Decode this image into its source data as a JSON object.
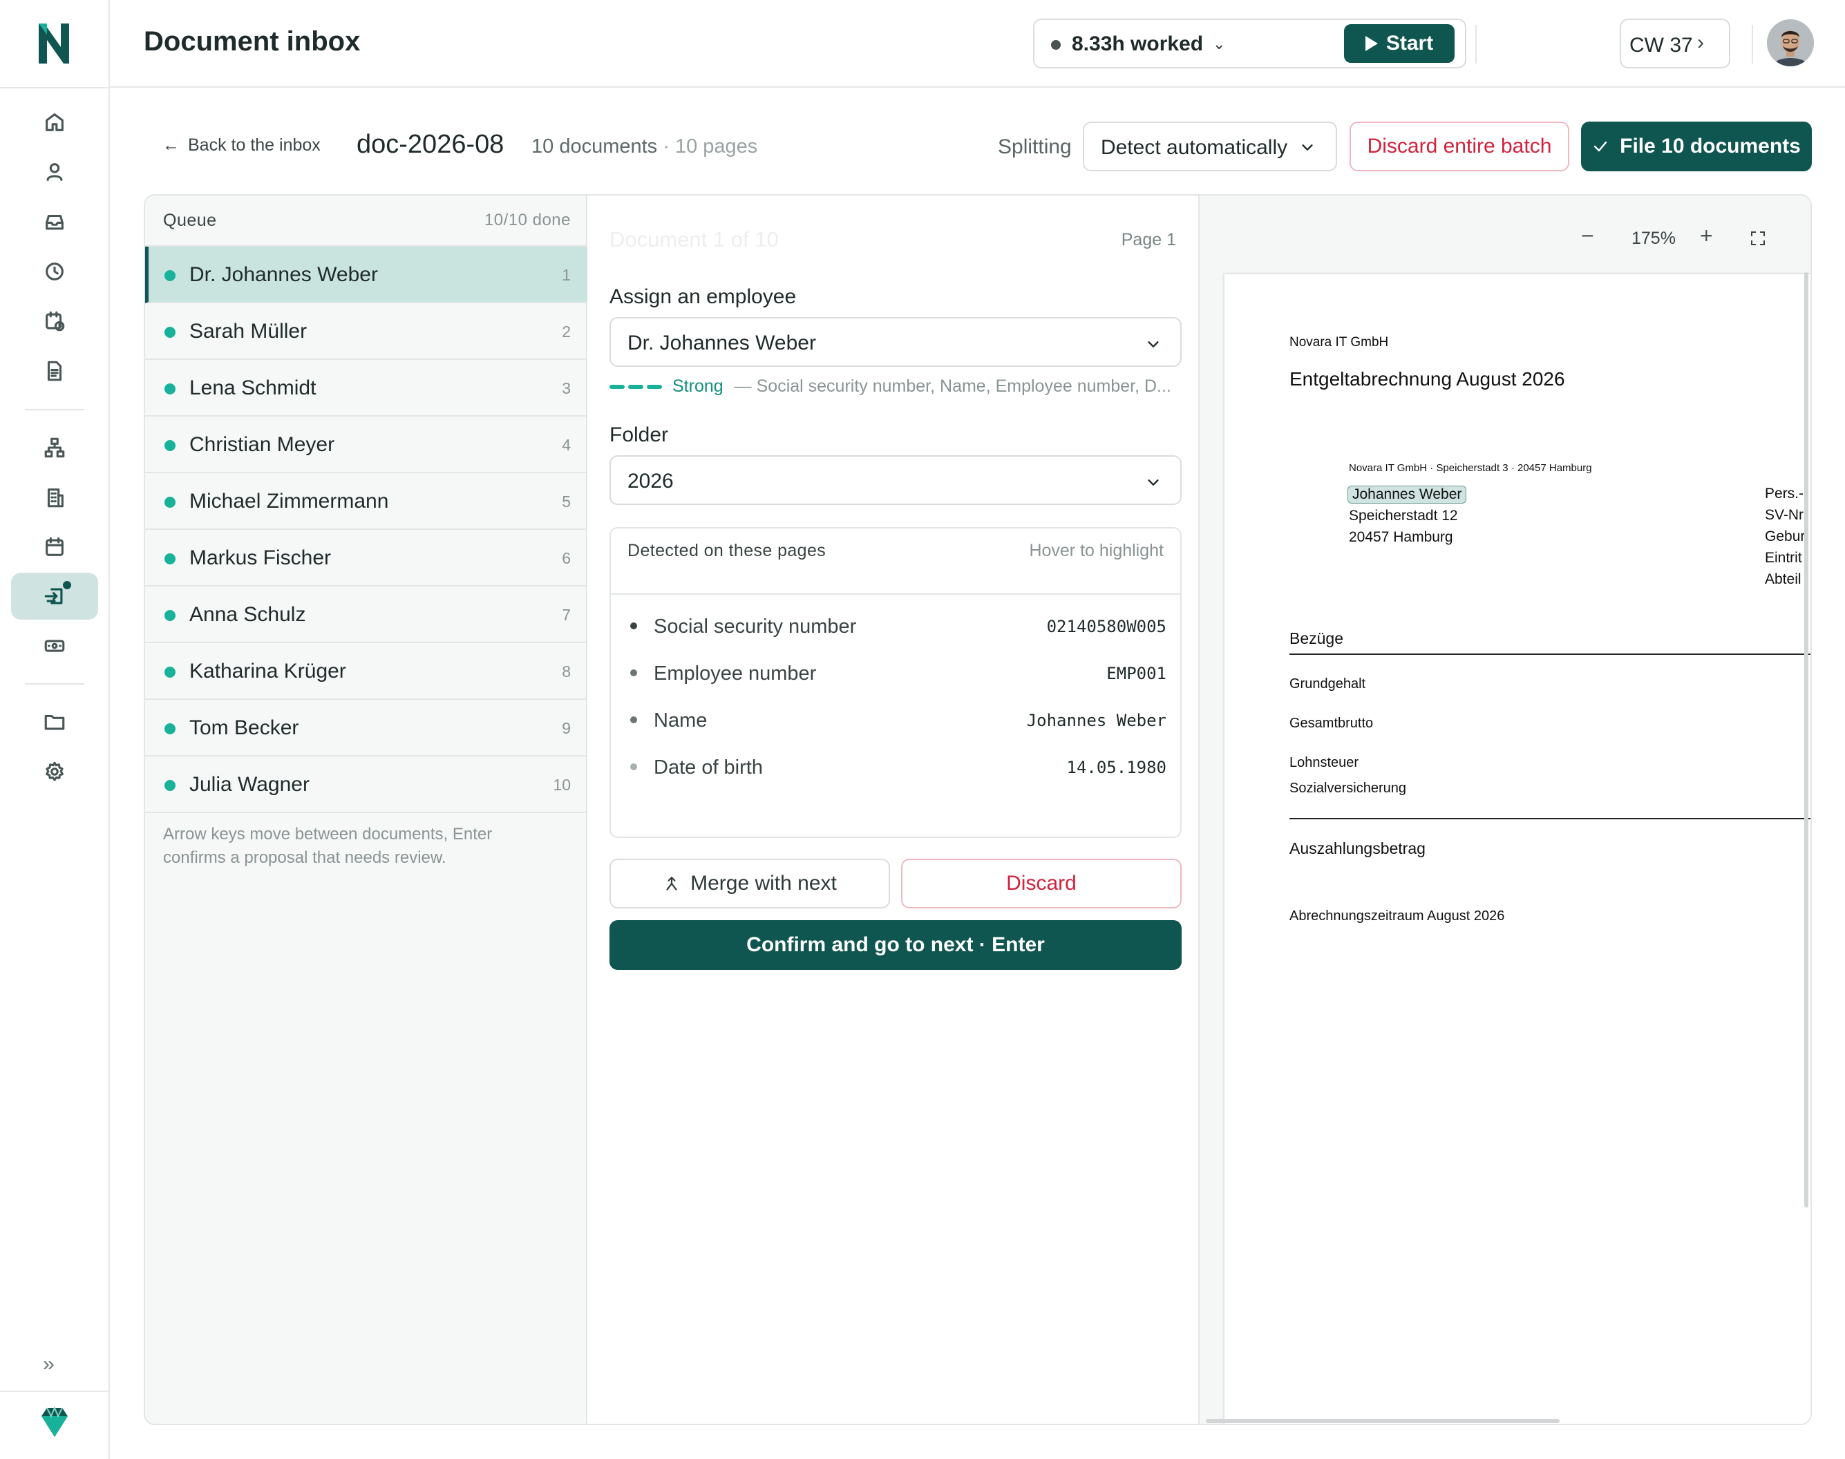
{
  "header": {
    "title": "Document inbox",
    "worked": "8.33h worked",
    "start_label": "Start",
    "week": "CW 37"
  },
  "rail": {
    "icons": [
      "home-icon",
      "person-icon",
      "inbox-icon",
      "clock-icon",
      "calendar-clock-icon",
      "document-icon",
      "org-chart-icon",
      "building-icon",
      "calendar-icon",
      "import-icon",
      "cash-icon",
      "folder-icon",
      "gear-icon"
    ],
    "active": "import-icon"
  },
  "toolbar": {
    "back_label": "Back to the inbox",
    "batch_id": "doc-2026-08",
    "documents": "10 documents",
    "pages": "10 pages",
    "splitting_label": "Splitting",
    "splitting_value": "Detect automatically",
    "discard_batch_label": "Discard entire batch",
    "file_label": "File 10 documents"
  },
  "queue": {
    "title": "Queue",
    "count": "10/10 done",
    "items": [
      {
        "name": "Dr. Johannes Weber",
        "num": "1"
      },
      {
        "name": "Sarah Müller",
        "num": "2"
      },
      {
        "name": "Lena Schmidt",
        "num": "3"
      },
      {
        "name": "Christian Meyer",
        "num": "4"
      },
      {
        "name": "Michael Zimmermann",
        "num": "5"
      },
      {
        "name": "Markus Fischer",
        "num": "6"
      },
      {
        "name": "Anna Schulz",
        "num": "7"
      },
      {
        "name": "Katharina Krüger",
        "num": "8"
      },
      {
        "name": "Tom Becker",
        "num": "9"
      },
      {
        "name": "Julia Wagner",
        "num": "10"
      }
    ],
    "hint": "Arrow keys move between documents, Enter confirms a proposal that needs review."
  },
  "detail": {
    "doc_of": "Document 1 of 10",
    "page": "Page 1",
    "assign_label": "Assign an employee",
    "assign_value": "Dr. Johannes Weber",
    "match_strength": "Strong",
    "match_detail": "— Social security number, Name, Employee number, D...",
    "folder_label": "Folder",
    "folder_value": "2026",
    "detected_title": "Detected on these pages",
    "detected_hint": "Hover to highlight",
    "detected": [
      {
        "key": "Social security number",
        "value": "02140580W005"
      },
      {
        "key": "Employee number",
        "value": "EMP001"
      },
      {
        "key": "Name",
        "value": "Johannes Weber"
      },
      {
        "key": "Date of birth",
        "value": "14.05.1980"
      }
    ],
    "merge_label": "Merge with next",
    "discard_label": "Discard",
    "confirm_label": "Confirm and go to next · Enter"
  },
  "preview": {
    "zoom": "175%",
    "company": "Novara IT GmbH",
    "title": "Entgeltabrechnung August 2026",
    "sender_line": "Novara IT GmbH · Speicherstadt 3 · 20457 Hamburg",
    "recipient_name": "Johannes Weber",
    "recipient_street": "Speicherstadt 12",
    "recipient_city": "20457 Hamburg",
    "right_labels": [
      "Pers.-",
      "SV-Nr",
      "Gebur",
      "Eintrit",
      "Abteil"
    ],
    "section_earnings": "Bezüge",
    "rows_a": [
      "Grundgehalt",
      "Gesamtbrutto",
      "Lohnsteuer",
      "Sozialversicherung"
    ],
    "payout": "Auszahlungsbetrag",
    "period": "Abrechnungszeitraum August 2026"
  },
  "colors": {
    "brand": "#0f5550",
    "accent": "#18b29a",
    "danger": "#d0223c"
  }
}
